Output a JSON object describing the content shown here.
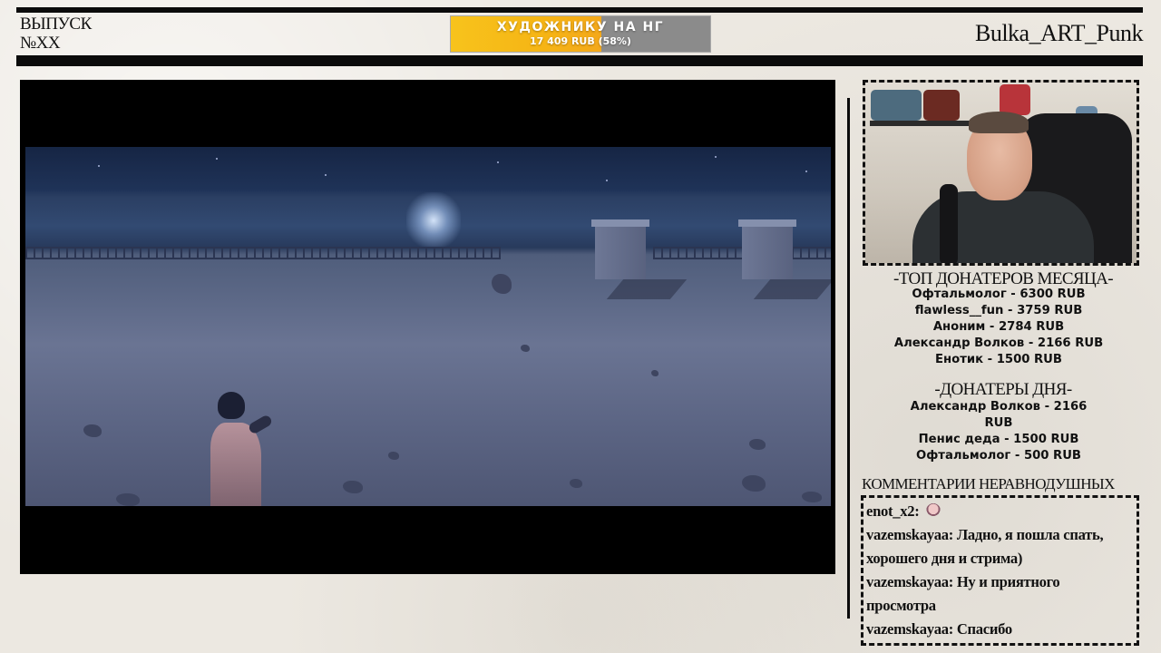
{
  "header": {
    "issue_line1": "ВЫПУСК",
    "issue_line2": "№XX",
    "streamer_name": "Bulka_ART_Punk"
  },
  "goal": {
    "title": "ХУДОЖНИКУ НА НГ",
    "amount": "17 409 RUB (58%)",
    "progress": 0.58,
    "fill_color": "#f6b515",
    "track_color": "#8b8b8b"
  },
  "video": {
    "description": ""
  },
  "top_donors": {
    "heading": "-ТОП ДОНАТЕРОВ МЕСЯЦА-",
    "entries": [
      "Офтальмолог - 6300 RUB",
      "flawless__fun - 3759 RUB",
      "Аноним - 2784 RUB",
      "Александр Волков - 2166 RUB",
      "Енотик - 1500 RUB"
    ]
  },
  "day_donors": {
    "heading": "-ДОНАТЕРЫ ДНЯ-",
    "entries": [
      "Александр Волков - 2166",
      "RUB",
      "Пенис деда - 1500 RUB",
      "Офтальмолог - 500 RUB"
    ]
  },
  "comments": {
    "heading": "КОММЕНТАРИИ НЕРАВНОДУШНЫХ",
    "messages": [
      {
        "user": "enot_x2:",
        "text": "",
        "emote": "girl-emote"
      },
      {
        "user": "vazemskayaa:",
        "text": "Ладно, я пошла спать, хорошего дня и стрима)"
      },
      {
        "user": "vazemskayaa:",
        "text": "Ну и приятного просмотра"
      },
      {
        "user": "vazemskayaa:",
        "text": "Спасибо"
      }
    ]
  },
  "colors": {
    "paper": "#ece8e1",
    "ink": "#0b0b0b",
    "accent": "#f6b515"
  }
}
